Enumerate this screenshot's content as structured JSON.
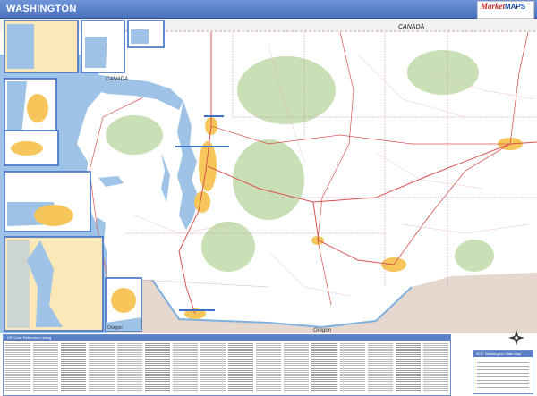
{
  "header": {
    "title": "WASHINGTON"
  },
  "brand": {
    "name_part1": "Market",
    "name_part2": "MAPS",
    "tagline": ""
  },
  "map": {
    "country_label_top": "CANADA",
    "country_label_inset": "CANADA",
    "state_label_south": "Oregon",
    "inset_label_oregon": "Oregon",
    "colors": {
      "water": "#9ec3e6",
      "urban": "#f6c65b",
      "forest": "#c9dfb5",
      "land": "#ffffff",
      "canada": "#f2f2f2",
      "oregon": "#e6d7cf",
      "inset_border": "#3f6fc4",
      "header": "#4a72c0"
    }
  },
  "zip_table": {
    "title": "ZIP Code Reference Listing"
  },
  "legend": {
    "title": "2017 Washington State Map"
  },
  "compass": {
    "north_icon": "compass-rose-icon"
  }
}
